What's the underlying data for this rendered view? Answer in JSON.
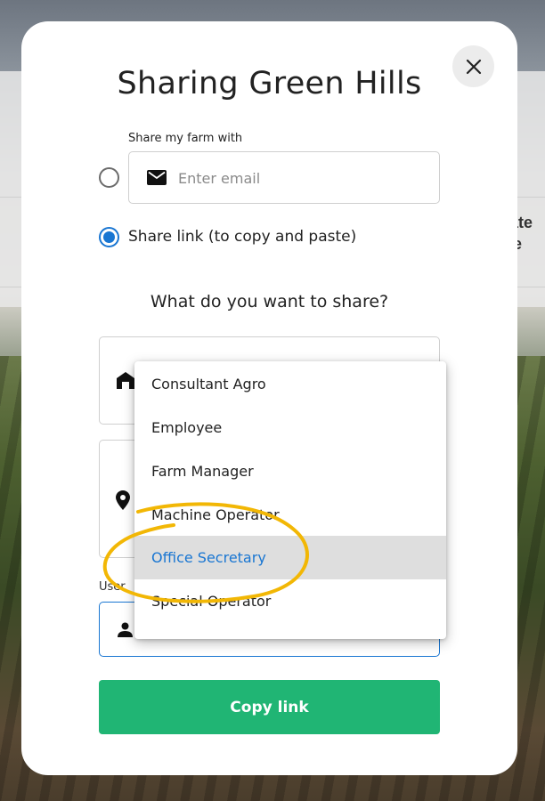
{
  "modal": {
    "title": "Sharing Green Hills",
    "share_with_label": "Share my farm with",
    "email_placeholder": "Enter email",
    "share_link_label": "Share link (to copy and paste)",
    "question": "What do you want to share?",
    "user_label_partial": "User",
    "copy_button": "Copy link",
    "close_icon": "close-icon",
    "selected_option": "share-link"
  },
  "background": {
    "side_text_line1": "ate",
    "side_text_line2": "e"
  },
  "dropdown": {
    "items": [
      {
        "label": "Consultant Agro"
      },
      {
        "label": "Employee"
      },
      {
        "label": "Farm Manager"
      },
      {
        "label": "Machine Operator"
      },
      {
        "label": "Office Secretary",
        "selected": true
      },
      {
        "label": "Special Operator"
      }
    ]
  },
  "colors": {
    "accent_blue": "#1976d2",
    "copy_button_green": "#20b574",
    "annotation_yellow": "#f2b705"
  },
  "icons": {
    "email": "email-icon",
    "farm": "barn-icon",
    "location": "location-pin-icon",
    "user": "person-icon"
  }
}
